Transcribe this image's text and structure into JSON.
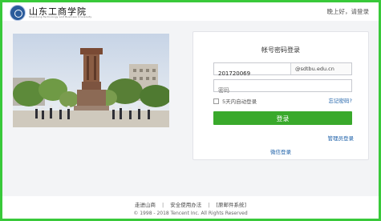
{
  "header": {
    "logo_cn": "山东工商学院",
    "logo_en": "Shandong Technology and Business University",
    "greeting": "晚上好，请登录"
  },
  "login": {
    "title": "帐号密码登录",
    "username_value": "201720069",
    "domain": "@sdtbu.edu.cn",
    "password_placeholder": "密码",
    "remember_label": "5天内自动登录",
    "forgot_link": "忘记密码?",
    "login_button": "登录",
    "admin_link": "管理员登录",
    "wechat_link": "微信登录"
  },
  "footer": {
    "links": [
      "走进山商",
      "安全使用办法",
      "原邮件系统"
    ],
    "copyright": "© 1998 - 2018 Tencent Inc. All Rights Reserved"
  },
  "colors": {
    "frame_border": "#39c93a",
    "login_button": "#39a92b",
    "link": "#1b5fa8",
    "band": "#f3f4f6"
  }
}
